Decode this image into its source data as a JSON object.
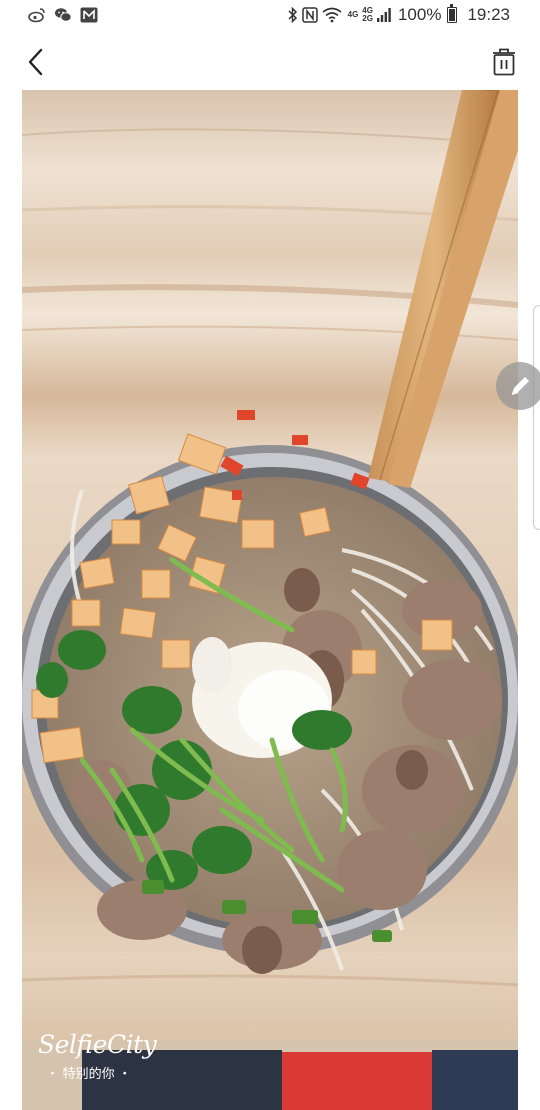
{
  "status_bar": {
    "left_icons": [
      "weibo-icon",
      "wechat-icon",
      "mail-icon"
    ],
    "right_icons": [
      "bluetooth-icon",
      "nfc-icon",
      "wifi-icon",
      "signal-icon",
      "battery-icon"
    ],
    "network_top": "4G",
    "network_mid": "4G",
    "network_bottom": "2G",
    "battery": "100%",
    "time": "19:23"
  },
  "toolbar": {
    "back_icon": "chevron-left-icon",
    "delete_icon": "trash-icon"
  },
  "photo": {
    "subject": "noodle-soup-bowl",
    "watermark_logo": "SelfieCity",
    "watermark_text": "・ 特别的你 ・"
  },
  "edit_button": {
    "icon": "pencil-icon"
  },
  "colors": {
    "background": "#ffffff",
    "status_text": "#333333",
    "fab": "#969696"
  }
}
